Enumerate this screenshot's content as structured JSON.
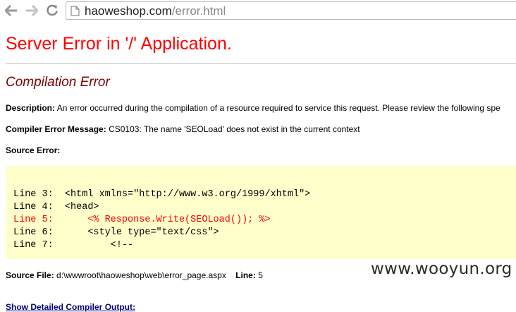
{
  "browser": {
    "url_host": "haoweshop.com",
    "url_path": "/error.html"
  },
  "page": {
    "heading": "Server Error in '/' Application.",
    "subheading": "Compilation Error",
    "description_label": "Description:",
    "description_text": "An error occurred during the compilation of a resource required to service this request. Please review the following spe",
    "compiler_message_label": "Compiler Error Message:",
    "compiler_message_text": "CS0103: The name 'SEOLoad' does not exist in the current context",
    "source_error_label": "Source Error:",
    "code_lines": [
      {
        "prefix": "Line 3:",
        "code": "<html xmlns=\"http://www.w3.org/1999/xhtml\">",
        "error": false
      },
      {
        "prefix": "Line 4:",
        "code": "<head>",
        "error": false
      },
      {
        "prefix": "Line 5:",
        "code": "    <% Response.Write(SEOLoad()); %>",
        "error": true
      },
      {
        "prefix": "Line 6:",
        "code": "    <style type=\"text/css\">",
        "error": false
      },
      {
        "prefix": "Line 7:",
        "code": "        <!--",
        "error": false
      }
    ],
    "source_file_label": "Source File:",
    "source_file_value": "d:\\wwwroot\\haoweshop\\web\\error_page.aspx",
    "line_label": "Line:",
    "line_value": "5",
    "detail_link": "Show Detailed Compiler Output:"
  },
  "watermark": "www.wooyun.org",
  "colors": {
    "heading": "#ff0000",
    "subheading": "#800000",
    "code_background": "#ffffcc",
    "error_line": "#ff0000",
    "link": "#000080"
  },
  "icons": [
    "back-arrow-icon",
    "forward-arrow-icon",
    "reload-icon",
    "page-icon"
  ]
}
